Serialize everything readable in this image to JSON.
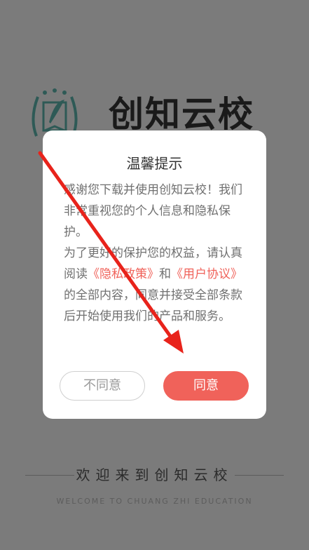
{
  "splash": {
    "logo_text": "创知云校",
    "welcome_text": "欢迎来到创知云校",
    "welcome_en": "WELCOME TO CHUANG ZHI EDUCATION"
  },
  "dialog": {
    "title": "温馨提示",
    "para1": "感谢您下载并使用创知云校！我们非常重视您的个人信息和隐私保护。",
    "para2_prefix": "为了更好的保护您的权益，请认真阅读",
    "privacy_link": "《隐私政策》",
    "and_text": "和",
    "user_link": "《用户协议》",
    "para2_suffix": "的全部内容，同意并接受全部条款后开始使用我们的产品和服务。",
    "disagree_label": "不同意",
    "agree_label": "同意"
  },
  "colors": {
    "accent": "#f0625a",
    "overlay": "#7b7b7b",
    "annotation_arrow": "#e8231b"
  }
}
